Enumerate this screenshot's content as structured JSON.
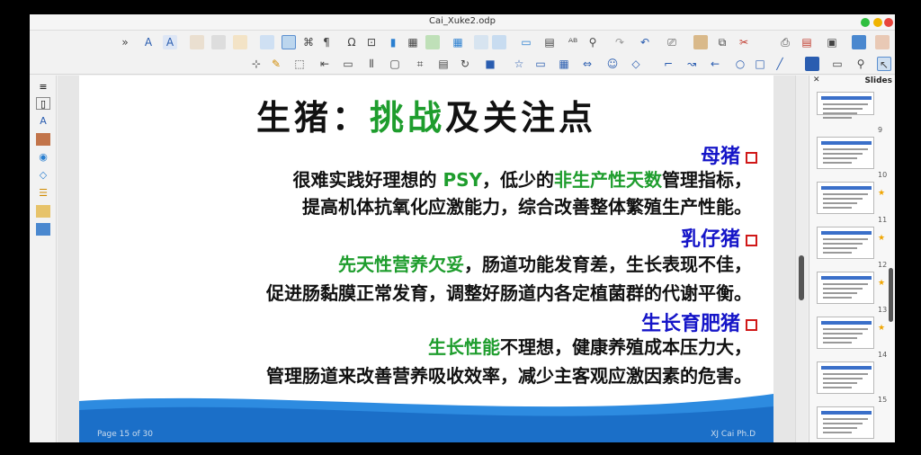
{
  "window": {
    "title": "Cai_Xuke2.odp"
  },
  "slide": {
    "title_pre": "生猪：",
    "title_hl": "挑战",
    "title_post": "及关注点",
    "sections": [
      {
        "heading": "母猪",
        "lines": [
          [
            {
              "t": "很难实践好理想的 "
            },
            {
              "t": "PSY",
              "g": true
            },
            {
              "t": "，低少的"
            },
            {
              "t": "非生产性天数",
              "g": true
            },
            {
              "t": "管理指标，"
            }
          ],
          [
            {
              "t": "提高机体抗氧化应激能力，综合改善整体繁殖生产性能。"
            }
          ]
        ]
      },
      {
        "heading": "乳仔猪",
        "lines": [
          [
            {
              "t": "先天性营养欠妥",
              "g": true
            },
            {
              "t": "，肠道功能发育差，生长表现不佳，"
            }
          ],
          [
            {
              "t": "促进肠黏膜正常发育，调整好肠道内各定植菌群的代谢平衡。"
            }
          ]
        ]
      },
      {
        "heading": "生长育肥猪",
        "lines": [
          [
            {
              "t": "生长性能",
              "g": true
            },
            {
              "t": "不理想，健康养殖成本压力大，"
            }
          ],
          [
            {
              "t": "管理肠道来改善营养吸收效率，减少主客观应激因素的危害。"
            }
          ]
        ]
      }
    ],
    "footer_left": "Page 15 of 30",
    "footer_right": "XJ Cai Ph.D"
  },
  "slide_pane": {
    "title": "Slides",
    "numbers": [
      "9",
      "10",
      "11",
      "12",
      "13",
      "14",
      "15"
    ]
  }
}
